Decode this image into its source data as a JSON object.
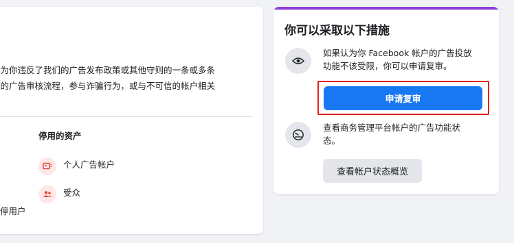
{
  "left": {
    "description_lines": [
      "因为你违反了我们的广告发布政策或其他守则的一条或多条",
      "们的广告审核流程，参与诈骗行为，或与不可信的帐户相关"
    ],
    "assets_title": "停用的资产",
    "assets": [
      {
        "label": "个人广告帐户",
        "icon": "ad-account-icon"
      },
      {
        "label": "受众",
        "icon": "audience-icon"
      }
    ],
    "disabled_user": "停用户"
  },
  "right": {
    "title": "你可以采取以下措施",
    "action1": {
      "icon": "eye-icon",
      "lines": [
        "如果认为你 Facebook 帐户的广告投放",
        "功能不该受限，你可以申请复审。"
      ],
      "button": "申请复审"
    },
    "action2": {
      "icon": "gauge-icon",
      "lines": [
        "查看商务管理平台帐户的广告功能状",
        "态。"
      ],
      "button": "查看帐户状态概览"
    }
  },
  "colors": {
    "primary": "#1877f2",
    "accent_bar": "#8b3dd9",
    "highlight": "#e0201b",
    "asset_icon_bg": "#fde8e6",
    "asset_icon_fg": "#e0453a"
  }
}
